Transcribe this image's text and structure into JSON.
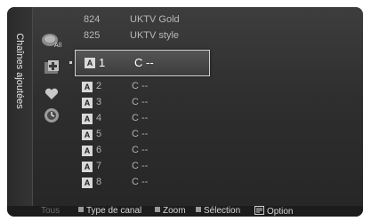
{
  "sidebar": {
    "title": "Chaînes ajoutées"
  },
  "icons": [
    {
      "name": "all-channels-icon"
    },
    {
      "name": "added-channels-icon"
    },
    {
      "name": "favorites-icon"
    },
    {
      "name": "programmed-icon"
    }
  ],
  "list": {
    "top": [
      {
        "number": "824",
        "name": "UKTV Gold"
      },
      {
        "number": "825",
        "name": "UKTV style"
      }
    ],
    "selected": {
      "badge": "A",
      "number": "1",
      "channel": "C --"
    },
    "rows": [
      {
        "badge": "A",
        "number": "2",
        "channel": "C --"
      },
      {
        "badge": "A",
        "number": "3",
        "channel": "C --"
      },
      {
        "badge": "A",
        "number": "4",
        "channel": "C --"
      },
      {
        "badge": "A",
        "number": "5",
        "channel": "C --"
      },
      {
        "badge": "A",
        "number": "6",
        "channel": "C --"
      },
      {
        "badge": "A",
        "number": "7",
        "channel": "C --"
      },
      {
        "badge": "A",
        "number": "8",
        "channel": "C --"
      }
    ]
  },
  "footer": {
    "tous": "Tous",
    "type_canal": "Type de canal",
    "zoom": "Zoom",
    "selection": "Sélection",
    "option": "Option"
  }
}
